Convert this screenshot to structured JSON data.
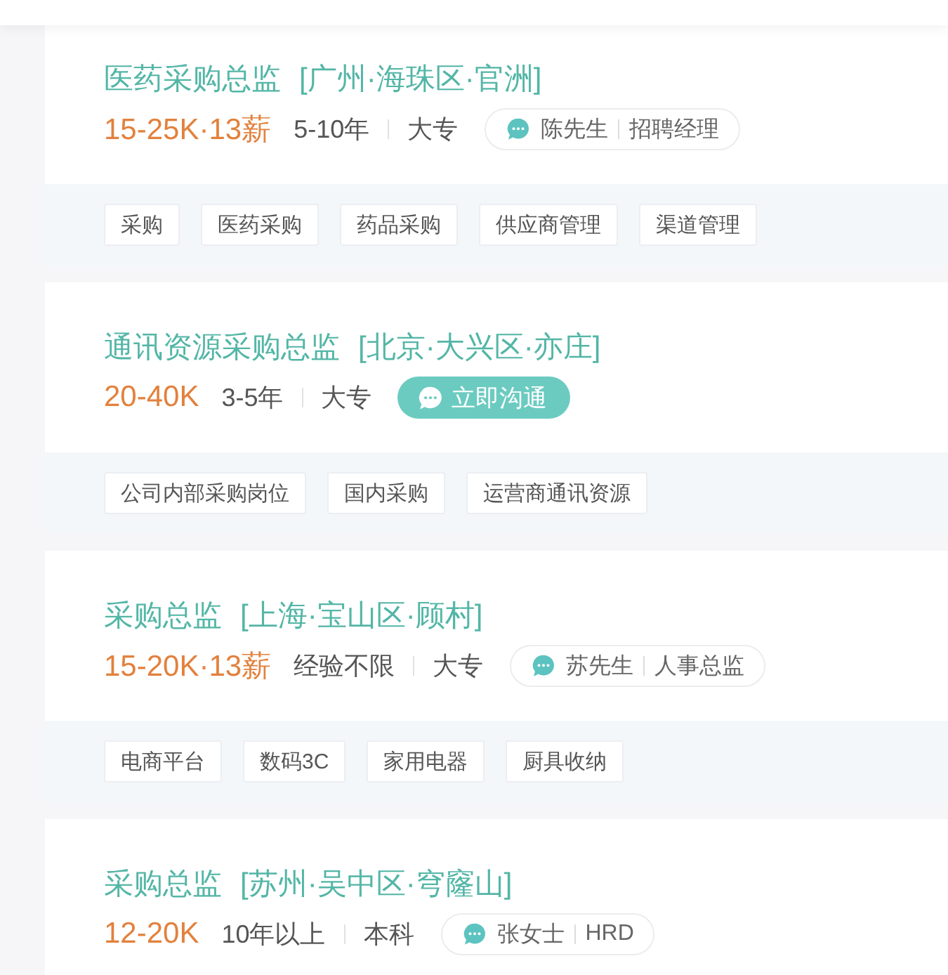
{
  "jobs": [
    {
      "title": "医药采购总监",
      "location": "[广州·海珠区·官洲]",
      "salary": "15-25K·13薪",
      "experience": "5-10年",
      "education": "大专",
      "contact": {
        "kind": "recruiter",
        "name": "陈先生",
        "role": "招聘经理"
      },
      "tags": [
        "采购",
        "医药采购",
        "药品采购",
        "供应商管理",
        "渠道管理"
      ]
    },
    {
      "title": "通讯资源采购总监",
      "location": "[北京·大兴区·亦庄]",
      "salary": "20-40K",
      "experience": "3-5年",
      "education": "大专",
      "contact": {
        "kind": "chat_button",
        "label": "立即沟通"
      },
      "tags": [
        "公司内部采购岗位",
        "国内采购",
        "运营商通讯资源"
      ]
    },
    {
      "title": "采购总监",
      "location": "[上海·宝山区·顾村]",
      "salary": "15-20K·13薪",
      "experience": "经验不限",
      "education": "大专",
      "contact": {
        "kind": "recruiter",
        "name": "苏先生",
        "role": "人事总监"
      },
      "tags": [
        "电商平台",
        "数码3C",
        "家用电器",
        "厨具收纳"
      ]
    },
    {
      "title": "采购总监",
      "location": "[苏州·吴中区·穹窿山]",
      "salary": "12-20K",
      "experience": "10年以上",
      "education": "本科",
      "contact": {
        "kind": "recruiter",
        "name": "张女士",
        "role": "HRD"
      }
    }
  ]
}
